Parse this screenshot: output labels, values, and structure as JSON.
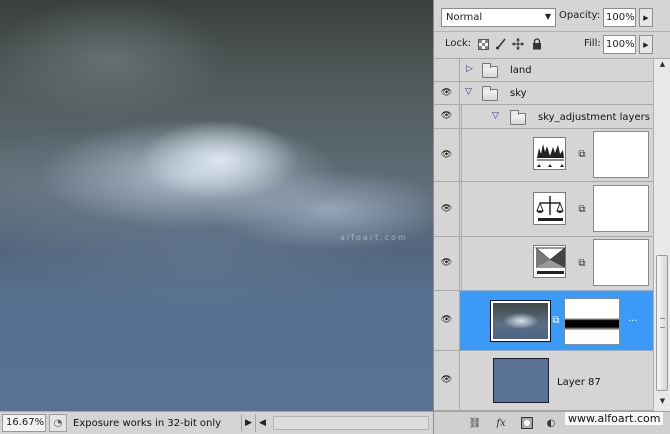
{
  "canvas": {
    "watermark": "alfoart.com"
  },
  "status_bar": {
    "zoom": "16.67%",
    "info_text": "Exposure works in 32-bit only",
    "arrow_right": "▶",
    "arrow_left": "◀"
  },
  "layers_panel": {
    "blend_mode": "Normal",
    "opacity_label": "Opacity:",
    "opacity_value": "100%",
    "lock_label": "Lock:",
    "fill_label": "Fill:",
    "fill_value": "100%",
    "selected_color": "#3b9af5",
    "layers": [
      {
        "name": "land",
        "type": "group",
        "expanded": false,
        "visible": false
      },
      {
        "name": "sky",
        "type": "group",
        "expanded": true,
        "visible": true
      },
      {
        "name": "sky_adjustment layers",
        "type": "group",
        "expanded": true,
        "visible": true
      },
      {
        "name": "",
        "type": "adjustment",
        "icon": "levels-icon",
        "visible": true
      },
      {
        "name": "",
        "type": "adjustment",
        "icon": "exposure-icon",
        "visible": true
      },
      {
        "name": "",
        "type": "adjustment",
        "icon": "gradient-map-icon",
        "visible": true
      },
      {
        "name": "",
        "type": "image-with-mask",
        "selected": true,
        "visible": true
      },
      {
        "name": "Layer 87",
        "type": "fill",
        "color": "#5a7196",
        "visible": true
      }
    ]
  },
  "footer": {
    "watermark": "www.alfoart.com"
  }
}
